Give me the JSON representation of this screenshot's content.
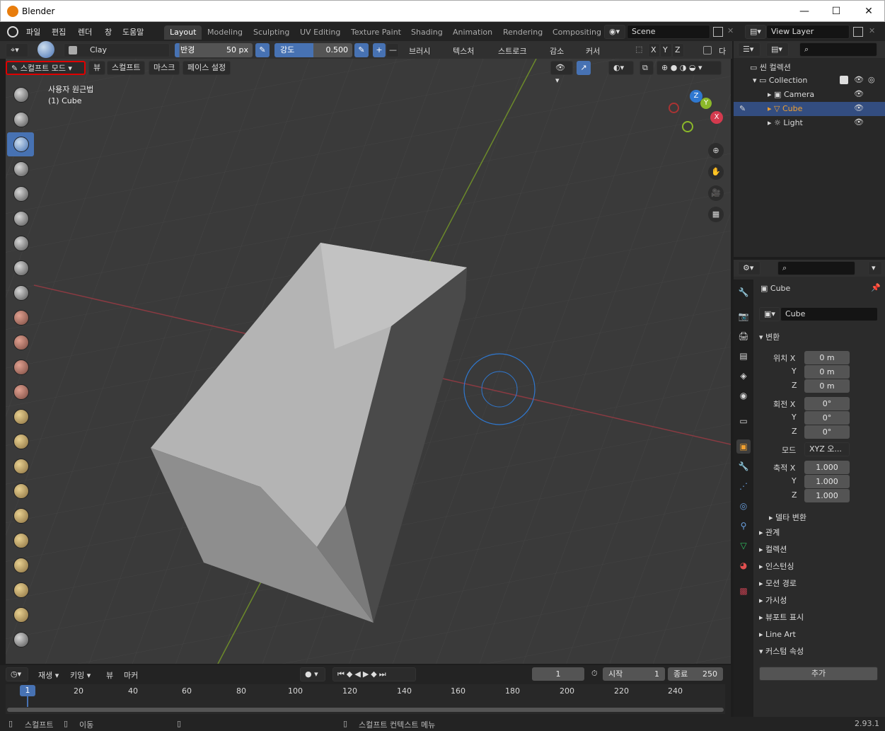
{
  "window": {
    "title": "Blender",
    "min": "—",
    "max": "☐",
    "close": "✕"
  },
  "menus": [
    "파일",
    "편집",
    "렌더",
    "창",
    "도움말"
  ],
  "workspaces": [
    "Layout",
    "Modeling",
    "Sculpting",
    "UV Editing",
    "Texture Paint",
    "Shading",
    "Animation",
    "Rendering",
    "Compositing"
  ],
  "scene": {
    "name": "Scene",
    "view_layer": "View Layer"
  },
  "tool_header": {
    "brush_name": "Clay",
    "radius_label": "반경",
    "radius_value": "50 px",
    "strength_label": "강도",
    "strength_value": "0.500",
    "plus": "+",
    "minus": "—",
    "menus": [
      "브러시",
      "텍스처",
      "스트로크",
      "감소",
      "커서"
    ],
    "axis": [
      "X",
      "Y",
      "Z"
    ],
    "extra": "다"
  },
  "mode_bar": {
    "mode": "스컬프트 모드",
    "items": [
      "뷰",
      "스컬프트",
      "마스크",
      "페이스 설정"
    ]
  },
  "viewport": {
    "overlay_title": "사용자 원근법",
    "overlay_object": "(1) Cube",
    "gizmo": {
      "z": "Z",
      "y": "Y",
      "x": "X"
    }
  },
  "outliner": {
    "root": "씬 컬렉션",
    "collection": "Collection",
    "items": [
      {
        "name": "Camera",
        "icon": "camera-icon"
      },
      {
        "name": "Cube",
        "icon": "mesh-icon"
      },
      {
        "name": "Light",
        "icon": "light-icon"
      }
    ]
  },
  "properties": {
    "object_name": "Cube",
    "data_name": "Cube",
    "transform": "변환",
    "location_label": "위치 X",
    "rotation_label": "회전 X",
    "scale_label": "축적 X",
    "axis_y": "Y",
    "axis_z": "Z",
    "loc": [
      "0 m",
      "0 m",
      "0 m"
    ],
    "rot": [
      "0°",
      "0°",
      "0°"
    ],
    "mode_label": "모드",
    "mode_value": "XYZ 오...",
    "scale": [
      "1.000",
      "1.000",
      "1.000"
    ],
    "delta": "델타 변환",
    "sections": [
      "관계",
      "컬렉션",
      "인스턴싱",
      "모션 경로",
      "가시성",
      "뷰포트 표시",
      "Line Art",
      "커스텀 속성"
    ],
    "add_button": "추가"
  },
  "timeline": {
    "menus": [
      "재생",
      "키잉",
      "뷰",
      "마커"
    ],
    "current_frame": "1",
    "start_label": "시작",
    "start": "1",
    "end_label": "종료",
    "end": "250",
    "ticks": [
      "1",
      "20",
      "40",
      "60",
      "80",
      "100",
      "120",
      "140",
      "160",
      "180",
      "200",
      "220",
      "240"
    ]
  },
  "statusbar": {
    "left": "스컬프트",
    "move": "이동",
    "context": "스컬프트 컨텍스트 메뉴",
    "version": "2.93.1"
  },
  "colors": {
    "accent": "#4772b3",
    "highlight_box": "#e00000"
  }
}
